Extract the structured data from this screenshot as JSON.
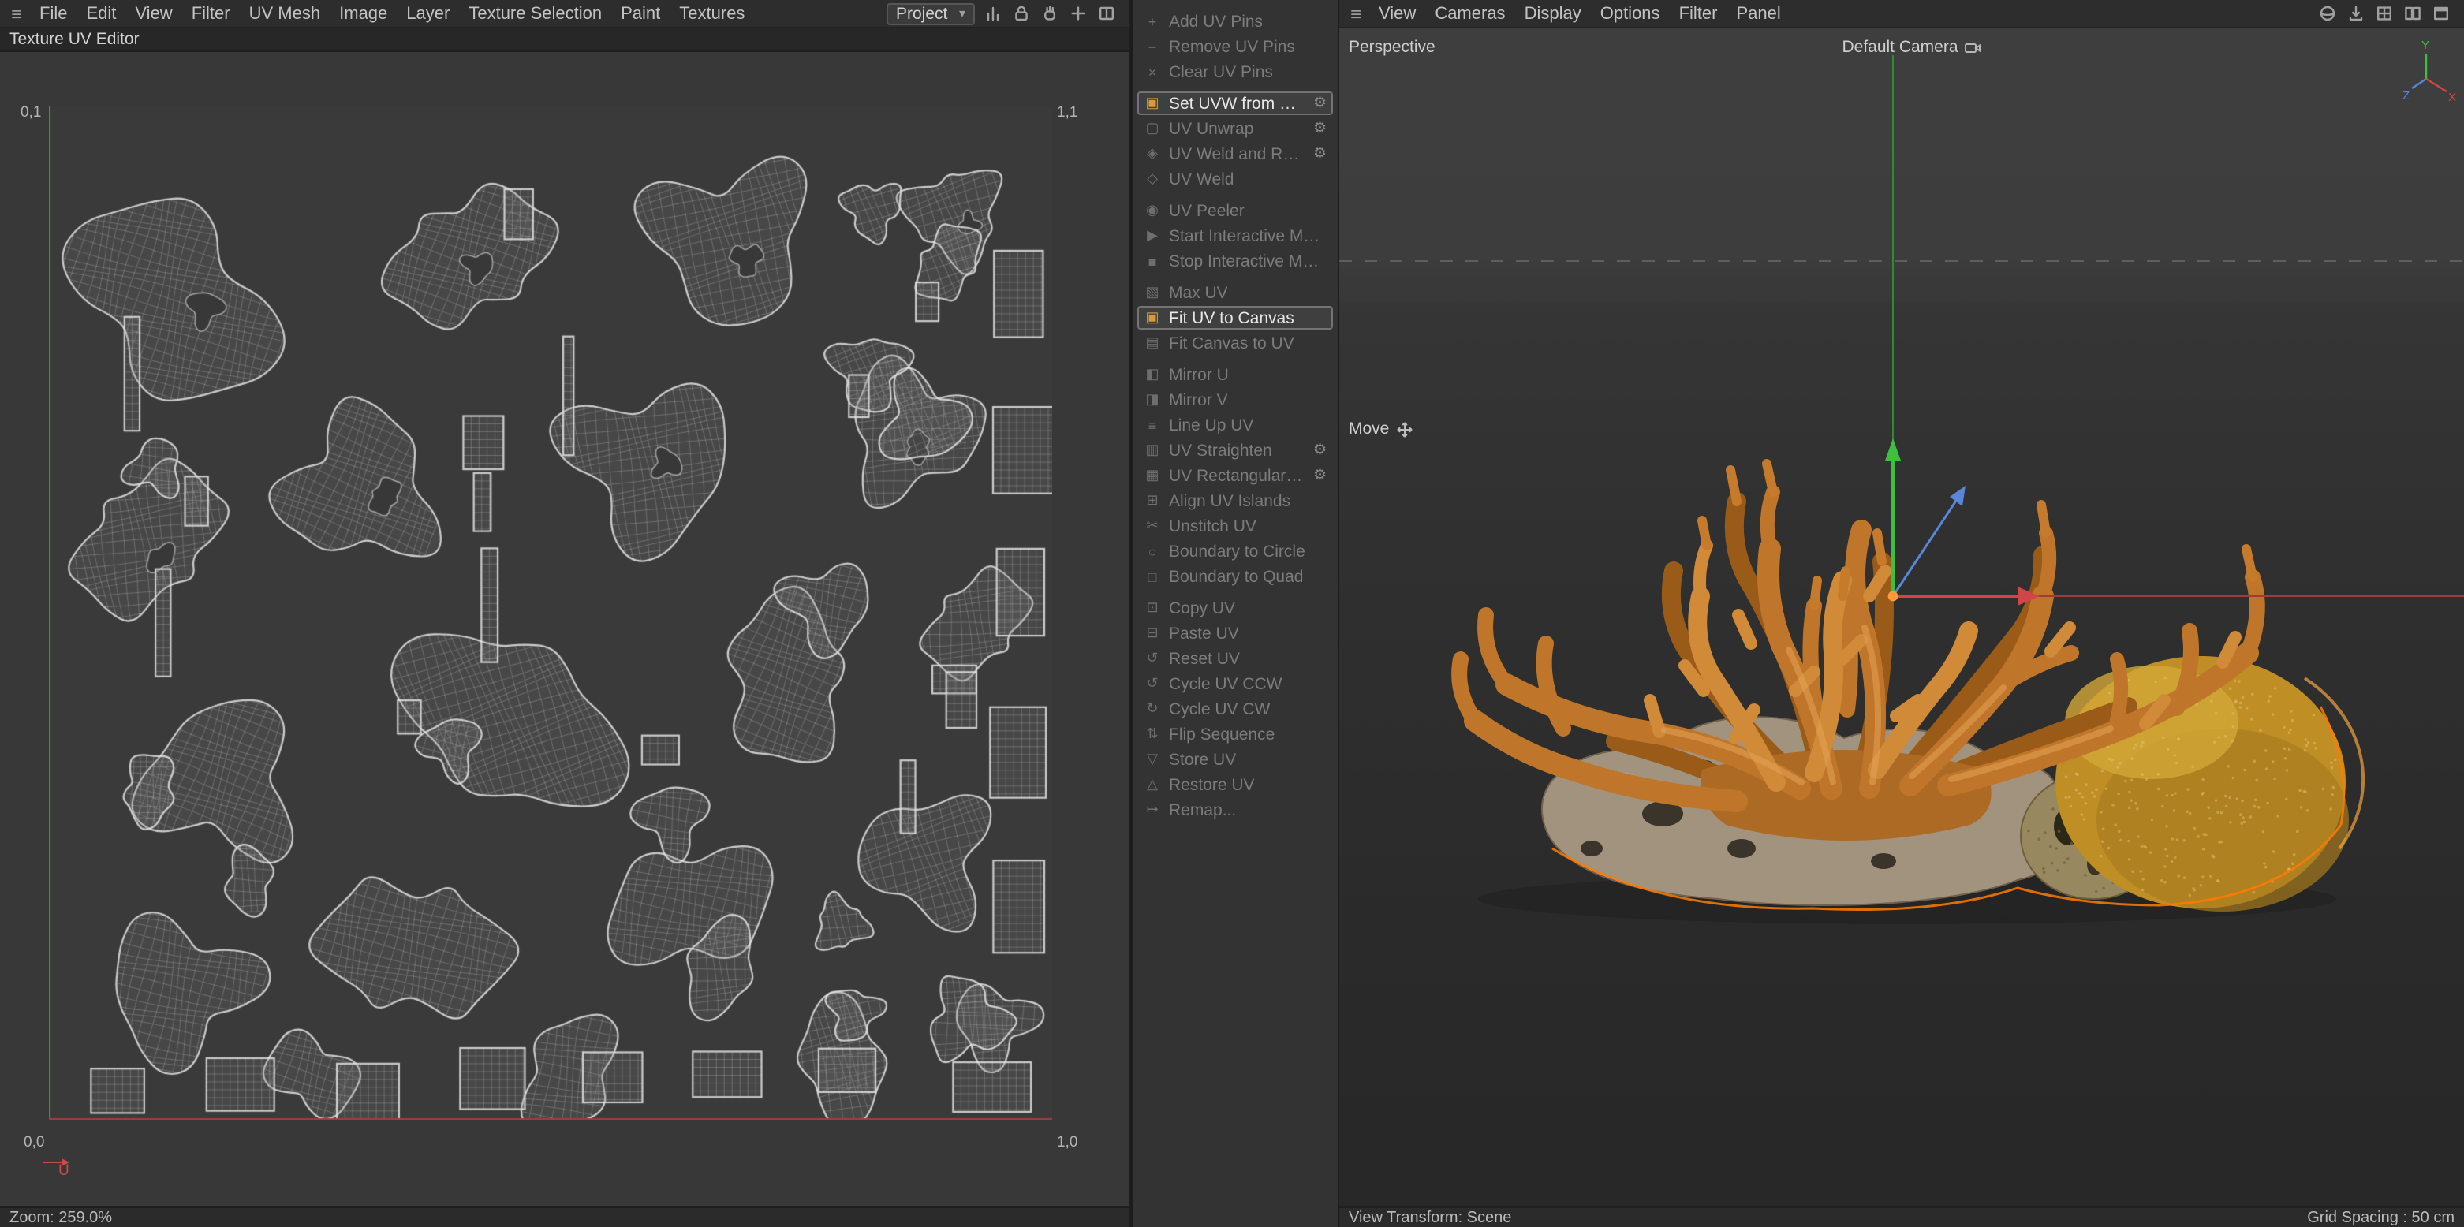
{
  "texture_editor": {
    "menu": [
      "File",
      "Edit",
      "View",
      "Filter",
      "UV Mesh",
      "Image",
      "Layer",
      "Texture Selection",
      "Paint",
      "Textures"
    ],
    "project_dropdown": "Project",
    "toolbar_icons": [
      "histogram-icon",
      "lock-icon",
      "pan-icon",
      "pick-icon",
      "layout-icon"
    ],
    "tab_title": "Texture UV Editor",
    "uv_canvas": {
      "corner_top_left": "0,1",
      "corner_top_right": "1,1",
      "corner_bottom_left": "0,0",
      "corner_bottom_right": "1,0",
      "u_axis_label": "U"
    },
    "status": {
      "zoom": "Zoom: 259.0%"
    }
  },
  "uv_commands": {
    "groups": [
      {
        "items": [
          {
            "label": "Add UV Pins",
            "icon": "+",
            "enabled": false,
            "gear": false
          },
          {
            "label": "Remove UV Pins",
            "icon": "−",
            "enabled": false,
            "gear": false
          },
          {
            "label": "Clear UV Pins",
            "icon": "×",
            "enabled": false,
            "gear": false
          }
        ]
      },
      {
        "items": [
          {
            "label": "Set UVW from Projection",
            "icon": "▣",
            "enabled": true,
            "gear": true
          },
          {
            "label": "UV Unwrap",
            "icon": "▢",
            "enabled": false,
            "gear": true
          },
          {
            "label": "UV Weld and Relax",
            "icon": "◈",
            "enabled": false,
            "gear": true
          },
          {
            "label": "UV Weld",
            "icon": "◇",
            "enabled": false,
            "gear": false
          }
        ]
      },
      {
        "items": [
          {
            "label": "UV Peeler",
            "icon": "◉",
            "enabled": false,
            "gear": false
          },
          {
            "label": "Start Interactive Mapping",
            "icon": "▶",
            "enabled": false,
            "gear": false
          },
          {
            "label": "Stop Interactive Mapping",
            "icon": "■",
            "enabled": false,
            "gear": false
          }
        ]
      },
      {
        "items": [
          {
            "label": "Max UV",
            "icon": "▧",
            "enabled": false,
            "gear": false
          },
          {
            "label": "Fit UV to Canvas",
            "icon": "▣",
            "enabled": true,
            "gear": false
          },
          {
            "label": "Fit Canvas to UV",
            "icon": "▤",
            "enabled": false,
            "gear": false
          }
        ]
      },
      {
        "items": [
          {
            "label": "Mirror U",
            "icon": "◧",
            "enabled": false,
            "gear": false
          },
          {
            "label": "Mirror V",
            "icon": "◨",
            "enabled": false,
            "gear": false
          },
          {
            "label": "Line Up UV",
            "icon": "≡",
            "enabled": false,
            "gear": false
          },
          {
            "label": "UV Straighten",
            "icon": "▥",
            "enabled": false,
            "gear": true
          },
          {
            "label": "UV Rectangularize",
            "icon": "▦",
            "enabled": false,
            "gear": true
          },
          {
            "label": "Align UV Islands",
            "icon": "⊞",
            "enabled": false,
            "gear": false
          },
          {
            "label": "Unstitch UV",
            "icon": "✂",
            "enabled": false,
            "gear": false
          },
          {
            "label": "Boundary to Circle",
            "icon": "○",
            "enabled": false,
            "gear": false
          },
          {
            "label": "Boundary to Quad",
            "icon": "□",
            "enabled": false,
            "gear": false
          }
        ]
      },
      {
        "items": [
          {
            "label": "Copy UV",
            "icon": "⊡",
            "enabled": false,
            "gear": false
          },
          {
            "label": "Paste UV",
            "icon": "⊟",
            "enabled": false,
            "gear": false
          },
          {
            "label": "Reset UV",
            "icon": "↺",
            "enabled": false,
            "gear": false
          },
          {
            "label": "Cycle UV CCW",
            "icon": "↺",
            "enabled": false,
            "gear": false
          },
          {
            "label": "Cycle UV CW",
            "icon": "↻",
            "enabled": false,
            "gear": false
          },
          {
            "label": "Flip Sequence",
            "icon": "⇅",
            "enabled": false,
            "gear": false
          },
          {
            "label": "Store UV",
            "icon": "▽",
            "enabled": false,
            "gear": false
          },
          {
            "label": "Restore UV",
            "icon": "△",
            "enabled": false,
            "gear": false
          },
          {
            "label": "Remap...",
            "icon": "↦",
            "enabled": false,
            "gear": false
          }
        ]
      }
    ]
  },
  "viewport": {
    "menu": [
      "View",
      "Cameras",
      "Display",
      "Options",
      "Filter",
      "Panel"
    ],
    "toolbar_icons": [
      "shading-sphere-icon",
      "download-icon",
      "grid-icon",
      "split-layout-icon",
      "maximize-icon"
    ],
    "view_label": "Perspective",
    "camera_label": "Default Camera",
    "tool_label": "Move",
    "axis": {
      "x": "X",
      "y": "Y",
      "z": "Z"
    },
    "status": {
      "left": "View Transform: Scene",
      "right": "Grid Spacing : 50 cm"
    }
  },
  "glyphs": {
    "hamburger": "≡",
    "gear": "⚙",
    "dropdown_arrow": "▾"
  },
  "colors": {
    "selection_orange": "#ff7b00",
    "axis_x_red": "#d04545",
    "axis_y_green": "#3fbf3f",
    "axis_z_blue": "#5b86d8",
    "coral_orange": "#c87b2e",
    "enabled_text": "#e8e8e8",
    "disabled_text": "#7c7c7c"
  }
}
